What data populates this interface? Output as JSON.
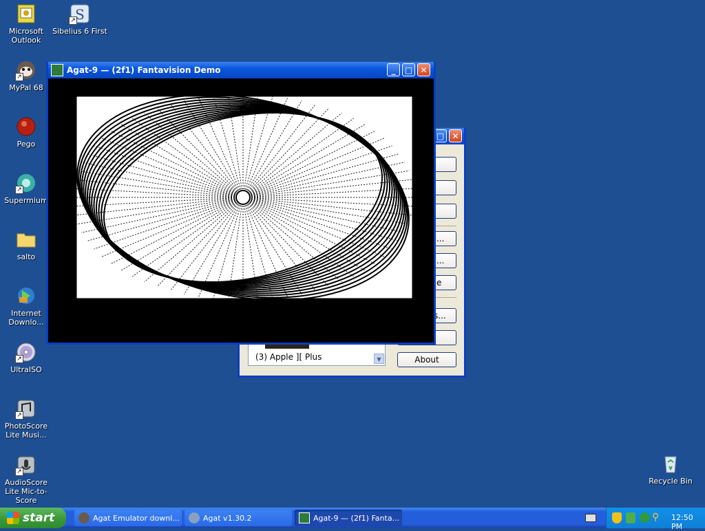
{
  "desktop": {
    "icons": [
      {
        "label": "Microsoft Outlook"
      },
      {
        "label": "Sibelius 6 First"
      },
      {
        "label": "MyPal 68"
      },
      {
        "label": "Pego"
      },
      {
        "label": "Supermium"
      },
      {
        "label": "salto"
      },
      {
        "label": "Internet Downlo..."
      },
      {
        "label": "UltraISO"
      },
      {
        "label": "PhotoScore Lite Musi..."
      },
      {
        "label": "AudioScore Lite Mic-to-Score"
      },
      {
        "label": "Recycle Bin"
      }
    ]
  },
  "agat_window": {
    "title": "Agat-9 — (2f1) Fantavision Demo"
  },
  "back_dialog": {
    "machine_select": "(3) Apple ][ Plus",
    "buttons": [
      "",
      "",
      "",
      "...",
      "...",
      "e",
      "s...",
      "",
      "About"
    ]
  },
  "taskbar": {
    "start_label": "start",
    "tasks": [
      {
        "label": "Agat Emulator downl..."
      },
      {
        "label": "Agat v1.30.2"
      },
      {
        "label": "Agat-9 — (2f1) Fanta..."
      }
    ],
    "clock": "12:50 PM"
  },
  "colors": {
    "desktop": "#1f4f93",
    "titlebar": "#0a56dd",
    "start_green": "#3c9a3c"
  }
}
